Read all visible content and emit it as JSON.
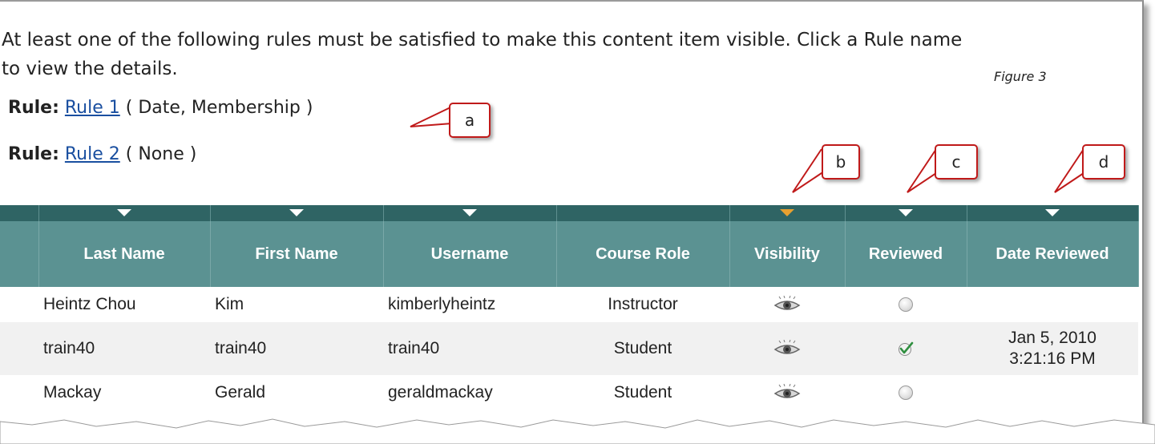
{
  "intro": {
    "line1": "At least one of the following rules must be satisfied to make this content item visible. Click a Rule name",
    "line2": "to view the details."
  },
  "figure_caption": "Figure 3",
  "rules": [
    {
      "label": "Rule:",
      "link": "Rule 1",
      "detail": "( Date, Membership )"
    },
    {
      "label": "Rule:",
      "link": "Rule 2",
      "detail": "( None )"
    }
  ],
  "callouts": {
    "a": "a",
    "b": "b",
    "c": "c",
    "d": "d"
  },
  "table": {
    "columns": [
      "Last Name",
      "First Name",
      "Username",
      "Course Role",
      "Visibility",
      "Reviewed",
      "Date Reviewed"
    ],
    "rows": [
      {
        "last": "Heintz Chou",
        "first": "Kim",
        "username": "kimberlyheintz",
        "role": "Instructor",
        "visibility": "eye-icon",
        "reviewed": "unchecked",
        "date1": "",
        "date2": ""
      },
      {
        "last": "train40",
        "first": "train40",
        "username": "train40",
        "role": "Student",
        "visibility": "eye-icon",
        "reviewed": "checked",
        "date1": "Jan 5, 2010",
        "date2": "3:21:16 PM"
      },
      {
        "last": "Mackay",
        "first": "Gerald",
        "username": "geraldmackay",
        "role": "Student",
        "visibility": "eye-icon",
        "reviewed": "unchecked",
        "date1": "",
        "date2": ""
      }
    ]
  },
  "colors": {
    "header_dark": "#2f6464",
    "header": "#5b9292",
    "sorted_arrow": "#e8a030",
    "callout_border": "#c01a1a",
    "link": "#1a4fa0"
  }
}
